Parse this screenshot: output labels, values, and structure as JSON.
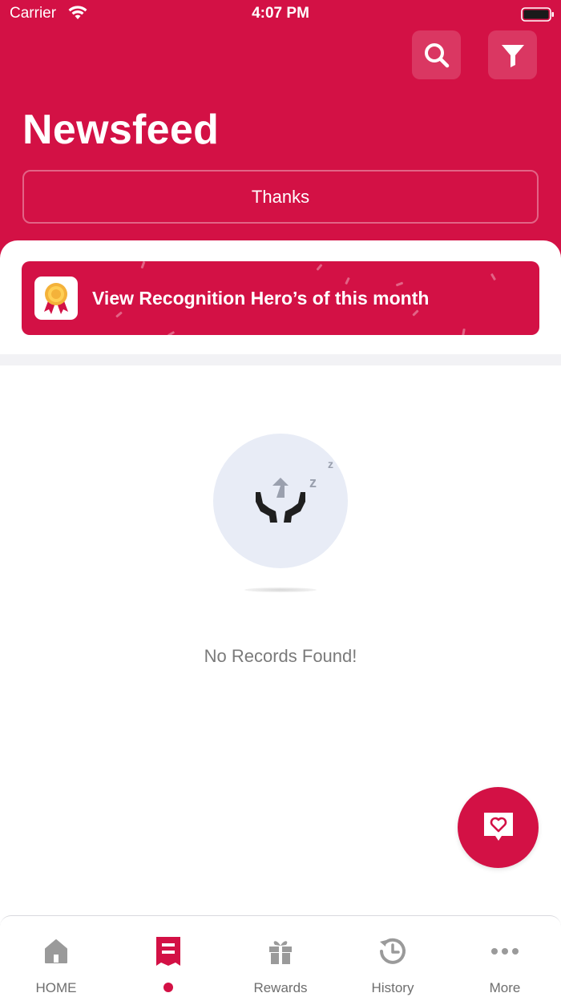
{
  "status_bar": {
    "carrier": "Carrier",
    "time": "4:07 PM"
  },
  "header": {
    "title": "Newsfeed",
    "search_icon": "search-icon",
    "filter_icon": "filter-icon",
    "tab_label": "Thanks"
  },
  "hero_banner": {
    "label": "View Recognition Hero’s of this month",
    "icon": "award-ribbon-icon"
  },
  "empty_state": {
    "message": "No Records Found!",
    "icon": "hands-sleeping-icon",
    "sleep_letters": [
      "z",
      "z"
    ]
  },
  "fab": {
    "icon": "heart-message-icon"
  },
  "bottom_nav": {
    "items": [
      {
        "label": "HOME",
        "icon": "home-icon"
      },
      {
        "label": "",
        "icon": "newsfeed-icon",
        "active": true
      },
      {
        "label": "Rewards",
        "icon": "gift-icon"
      },
      {
        "label": "History",
        "icon": "history-icon"
      },
      {
        "label": "More",
        "icon": "more-dots-icon"
      }
    ]
  },
  "colors": {
    "primary": "#D31145",
    "muted": "#7A7A7A",
    "nav_icon": "#9A9A9A"
  }
}
